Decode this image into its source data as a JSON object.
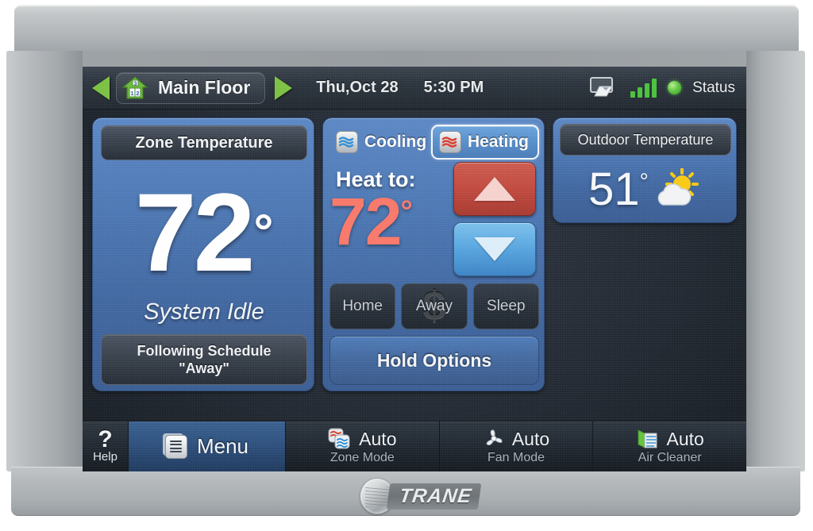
{
  "device": {
    "brand": "TRANE"
  },
  "topbar": {
    "prev_icon": "triangle-left-icon",
    "next_icon": "triangle-right-icon",
    "house_icon": "house-zone-icon",
    "zone_name": "Main Floor",
    "date": "Thu,Oct 28",
    "time": "5:30 PM",
    "screen_lock_icon": "screen-touch-icon",
    "signal_icon": "signal-bars-icon",
    "status_dot": "green-status-dot-icon",
    "status_label": "Status"
  },
  "zone_panel": {
    "header": "Zone Temperature",
    "temperature": "72",
    "degree": "°",
    "system_state": "System Idle",
    "schedule_line1": "Following Schedule",
    "schedule_line2": "\"Away\""
  },
  "control_panel": {
    "cooling_label": "Cooling",
    "cooling_icon": "cool-wave-icon",
    "heating_label": "Heating",
    "heating_icon": "heat-wave-icon",
    "active_mode": "Heating",
    "setpoint_label": "Heat to:",
    "setpoint_value": "72",
    "setpoint_degree": "°",
    "increase_icon": "arrow-up-icon",
    "decrease_icon": "arrow-down-icon",
    "presets": [
      "Home",
      "Away",
      "Sleep"
    ],
    "active_preset": "Away",
    "preset_badge": "$",
    "hold_options": "Hold Options"
  },
  "outdoor_panel": {
    "header": "Outdoor Temperature",
    "temperature": "51",
    "degree": "°",
    "weather_icon": "partly-cloudy-sun-icon"
  },
  "bottombar": {
    "help_symbol": "?",
    "help_label": "Help",
    "menu_label": "Menu",
    "menu_icon": "menu-list-icon",
    "modes": [
      {
        "value": "Auto",
        "label": "Zone Mode",
        "icon": "zone-mode-icon"
      },
      {
        "value": "Auto",
        "label": "Fan Mode",
        "icon": "fan-blade-icon"
      },
      {
        "value": "Auto",
        "label": "Air Cleaner",
        "icon": "air-filter-icon"
      }
    ]
  },
  "colors": {
    "accent_green": "#7cc143",
    "heat_red": "#f8786a",
    "panel_blue": "#4e79b5",
    "status_green": "#49c23c"
  }
}
